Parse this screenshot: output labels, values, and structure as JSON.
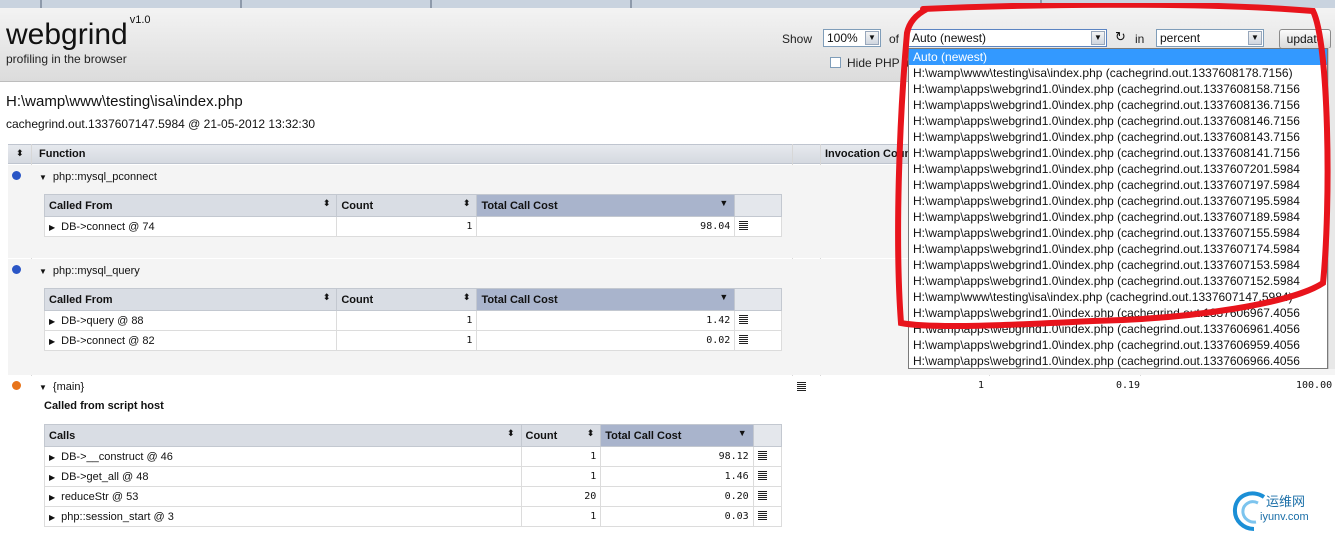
{
  "header": {
    "logo": "webgrind",
    "version": "v1.0",
    "tagline": "profiling in the browser",
    "show_label": "Show",
    "show_value": "100%",
    "of_label": "of",
    "file_selected": "Auto (newest)",
    "in_label": "in",
    "unit_value": "percent",
    "update_label": "update",
    "hide_php_label": "Hide PHP functions"
  },
  "dropdown": {
    "options": [
      "Auto (newest)",
      "H:\\wamp\\www\\testing\\isa\\index.php (cachegrind.out.1337608178.7156)",
      "H:\\wamp\\apps\\webgrind1.0\\index.php (cachegrind.out.1337608158.7156",
      "H:\\wamp\\apps\\webgrind1.0\\index.php (cachegrind.out.1337608136.7156",
      "H:\\wamp\\apps\\webgrind1.0\\index.php (cachegrind.out.1337608146.7156",
      "H:\\wamp\\apps\\webgrind1.0\\index.php (cachegrind.out.1337608143.7156",
      "H:\\wamp\\apps\\webgrind1.0\\index.php (cachegrind.out.1337608141.7156",
      "H:\\wamp\\apps\\webgrind1.0\\index.php (cachegrind.out.1337607201.5984",
      "H:\\wamp\\apps\\webgrind1.0\\index.php (cachegrind.out.1337607197.5984",
      "H:\\wamp\\apps\\webgrind1.0\\index.php (cachegrind.out.1337607195.5984",
      "H:\\wamp\\apps\\webgrind1.0\\index.php (cachegrind.out.1337607189.5984",
      "H:\\wamp\\apps\\webgrind1.0\\index.php (cachegrind.out.1337607155.5984",
      "H:\\wamp\\apps\\webgrind1.0\\index.php (cachegrind.out.1337607174.5984",
      "H:\\wamp\\apps\\webgrind1.0\\index.php (cachegrind.out.1337607153.5984",
      "H:\\wamp\\apps\\webgrind1.0\\index.php (cachegrind.out.1337607152.5984",
      "H:\\wamp\\www\\testing\\isa\\index.php (cachegrind.out.1337607147.5984)",
      "H:\\wamp\\apps\\webgrind1.0\\index.php (cachegrind.out.1337606967.4056",
      "H:\\wamp\\apps\\webgrind1.0\\index.php (cachegrind.out.1337606961.4056",
      "H:\\wamp\\apps\\webgrind1.0\\index.php (cachegrind.out.1337606959.4056",
      "H:\\wamp\\apps\\webgrind1.0\\index.php (cachegrind.out.1337606966.4056"
    ]
  },
  "file": {
    "path": "H:\\wamp\\www\\testing\\isa\\index.php",
    "info": "cachegrind.out.1337607147.5984 @ 21-05-2012 13:32:30"
  },
  "table_header": {
    "function": "Function",
    "invocation_count": "Invocation Count"
  },
  "functions": [
    {
      "name": "php::mysql_pconnect",
      "sub_headers": [
        "Called From",
        "Count",
        "Total Call Cost"
      ],
      "rows": [
        {
          "label": "DB->connect @ 74",
          "count": "1",
          "cost": "98.04"
        }
      ]
    },
    {
      "name": "php::mysql_query",
      "sub_headers": [
        "Called From",
        "Count",
        "Total Call Cost"
      ],
      "rows": [
        {
          "label": "DB->query @ 88",
          "count": "1",
          "cost": "1.42"
        },
        {
          "label": "DB->connect @ 82",
          "count": "1",
          "cost": "0.02"
        }
      ]
    },
    {
      "name": "{main}",
      "invocation_count": "1",
      "self_cost": "0.19",
      "total_cost": "100.00",
      "called_from_note": "Called from script host",
      "sub_headers": [
        "Calls",
        "Count",
        "Total Call Cost"
      ],
      "rows": [
        {
          "label": "DB->__construct @ 46",
          "count": "1",
          "cost": "98.12"
        },
        {
          "label": "DB->get_all @ 48",
          "count": "1",
          "cost": "1.46"
        },
        {
          "label": "reduceStr @ 53",
          "count": "20",
          "cost": "0.20"
        },
        {
          "label": "php::session_start @ 3",
          "count": "1",
          "cost": "0.03"
        }
      ]
    }
  ],
  "watermark": {
    "cn": "运维网",
    "domain": "iyunv.com"
  },
  "colors": {
    "blue_dot": "#2a56c6",
    "orange_dot": "#e8741a",
    "annotation_red": "#e8141c",
    "selected_option": "#3399ff"
  }
}
